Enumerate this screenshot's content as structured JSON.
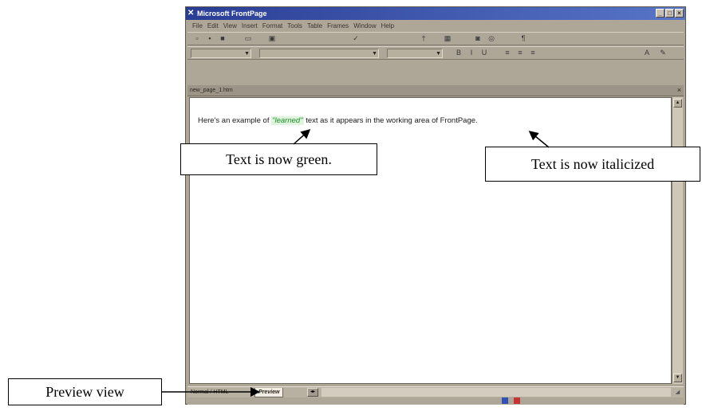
{
  "window": {
    "title": "Microsoft FrontPage",
    "app_icon": "frontpage-icon",
    "controls": [
      "minimize-icon",
      "maximize-icon",
      "close-icon"
    ]
  },
  "menu": [
    "File",
    "Edit",
    "View",
    "Insert",
    "Format",
    "Tools",
    "Table",
    "Frames",
    "Window",
    "Help"
  ],
  "document_tab": "new_page_1.htm",
  "content": {
    "before": "Here's an example of ",
    "highlighted": "\"learned\"",
    "after": " text as it appears in the working area of FrontPage."
  },
  "view_tabs": {
    "normal": "Normal",
    "html": "HTML",
    "preview": "Preview"
  },
  "statusbar": {
    "left": "",
    "right": ""
  },
  "callouts": {
    "green": "Text is now green.",
    "italic": "Text is now italicized",
    "preview": "Preview view"
  },
  "colors": {
    "highlight_text": "#1d8f2a",
    "titlebar": "#2a3d95"
  }
}
